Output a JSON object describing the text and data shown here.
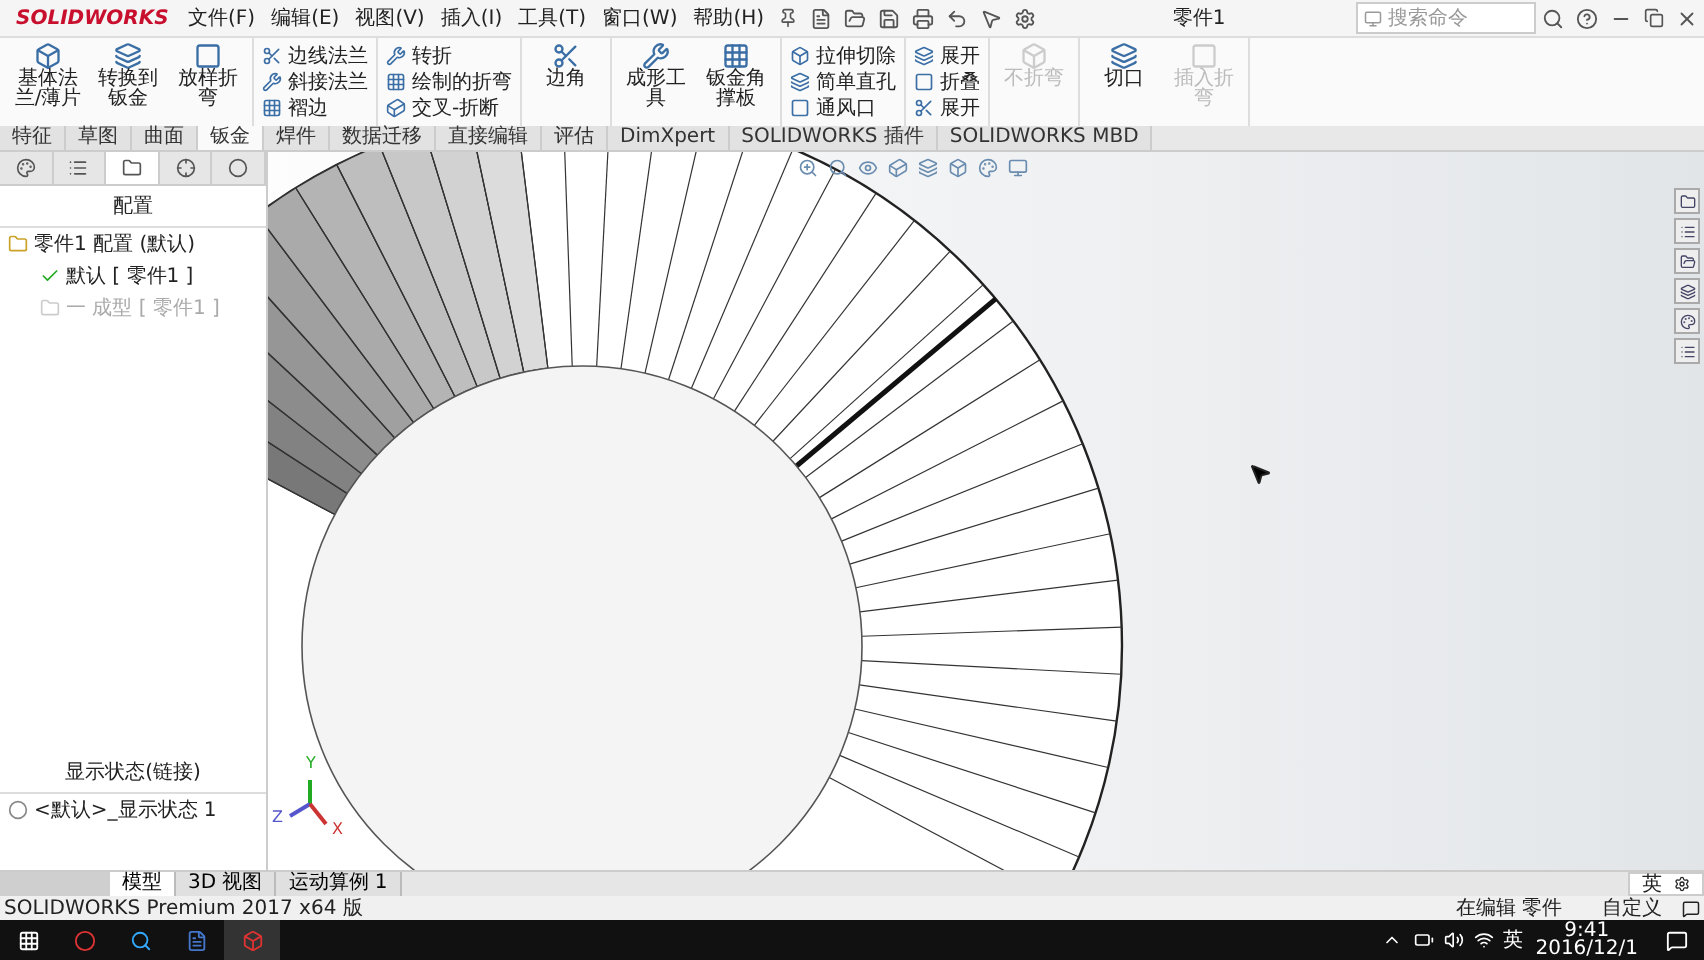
{
  "app": {
    "logo": "SOLIDWORKS",
    "title": "零件1",
    "search": {
      "placeholder": "搜索命令"
    }
  },
  "menus": [
    {
      "label": "文件(F)"
    },
    {
      "label": "编辑(E)"
    },
    {
      "label": "视图(V)"
    },
    {
      "label": "插入(I)"
    },
    {
      "label": "工具(T)"
    },
    {
      "label": "窗口(W)"
    },
    {
      "label": "帮助(H)"
    }
  ],
  "ribbon": [
    {
      "kind": "large",
      "items": [
        {
          "label": "基体法兰/薄片",
          "disabled": false
        },
        {
          "label": "转换到钣金",
          "disabled": false
        },
        {
          "label": "放样折弯",
          "disabled": false
        }
      ]
    },
    {
      "kind": "stack",
      "items": [
        {
          "label": "边线法兰",
          "disabled": false
        },
        {
          "label": "斜接法兰",
          "disabled": false
        },
        {
          "label": "褶边",
          "disabled": false
        }
      ]
    },
    {
      "kind": "stack",
      "items": [
        {
          "label": "转折",
          "disabled": false
        },
        {
          "label": "绘制的折弯",
          "disabled": false
        },
        {
          "label": "交叉-折断",
          "disabled": false
        }
      ]
    },
    {
      "kind": "large",
      "items": [
        {
          "label": "边角",
          "disabled": false
        }
      ]
    },
    {
      "kind": "large",
      "items": [
        {
          "label": "成形工具",
          "disabled": false
        },
        {
          "label": "钣金角撑板",
          "disabled": false
        }
      ]
    },
    {
      "kind": "stack",
      "items": [
        {
          "label": "拉伸切除",
          "disabled": false
        },
        {
          "label": "简单直孔",
          "disabled": false
        },
        {
          "label": "通风口",
          "disabled": false
        }
      ]
    },
    {
      "kind": "stack",
      "items": [
        {
          "label": "展开",
          "disabled": false
        },
        {
          "label": "折叠",
          "disabled": false
        },
        {
          "label": "展开",
          "disabled": false
        }
      ]
    },
    {
      "kind": "large",
      "items": [
        {
          "label": "不折弯",
          "disabled": true
        }
      ]
    },
    {
      "kind": "large",
      "items": [
        {
          "label": "切口",
          "disabled": false
        },
        {
          "label": "插入折弯",
          "disabled": true
        }
      ]
    }
  ],
  "command_tabs": [
    {
      "label": "特征",
      "selected": false
    },
    {
      "label": "草图",
      "selected": false
    },
    {
      "label": "曲面",
      "selected": false
    },
    {
      "label": "钣金",
      "selected": true
    },
    {
      "label": "焊件",
      "selected": false
    },
    {
      "label": "数据迁移",
      "selected": false
    },
    {
      "label": "直接编辑",
      "selected": false
    },
    {
      "label": "评估",
      "selected": false
    },
    {
      "label": "DimXpert",
      "selected": false
    },
    {
      "label": "SOLIDWORKS 插件",
      "selected": false
    },
    {
      "label": "SOLIDWORKS MBD",
      "selected": false
    }
  ],
  "panel_tabs": [
    {
      "selected": false
    },
    {
      "selected": false
    },
    {
      "selected": true
    },
    {
      "selected": false
    },
    {
      "selected": false
    }
  ],
  "config_panel": {
    "heading": "配置",
    "tree": [
      {
        "label": "零件1 配置 (默认)",
        "active": false,
        "children": [
          {
            "label": "默认 [ 零件1 ]",
            "active": true
          },
          {
            "label": "一 成型 [ 零件1 ]",
            "active": false
          }
        ]
      }
    ]
  },
  "display_state": {
    "heading": "显示状态(链接)",
    "items": [
      {
        "label": "<默认>_显示状态 1"
      }
    ]
  },
  "triad": {
    "labels": [
      "Y",
      "Z",
      "X"
    ]
  },
  "bottom_tabs": [
    {
      "label": "模型",
      "selected": true
    },
    {
      "label": "3D 视图",
      "selected": false
    },
    {
      "label": "运动算例 1",
      "selected": false
    }
  ],
  "ime_bar": {
    "label": "英"
  },
  "status_bar": {
    "product": "SOLIDWORKS Premium 2017 x64 版",
    "mode": "在编辑 零件",
    "units": "自定义"
  },
  "taskbar": {
    "ime": "英",
    "time": "9:41",
    "date": "2016/12/1"
  }
}
